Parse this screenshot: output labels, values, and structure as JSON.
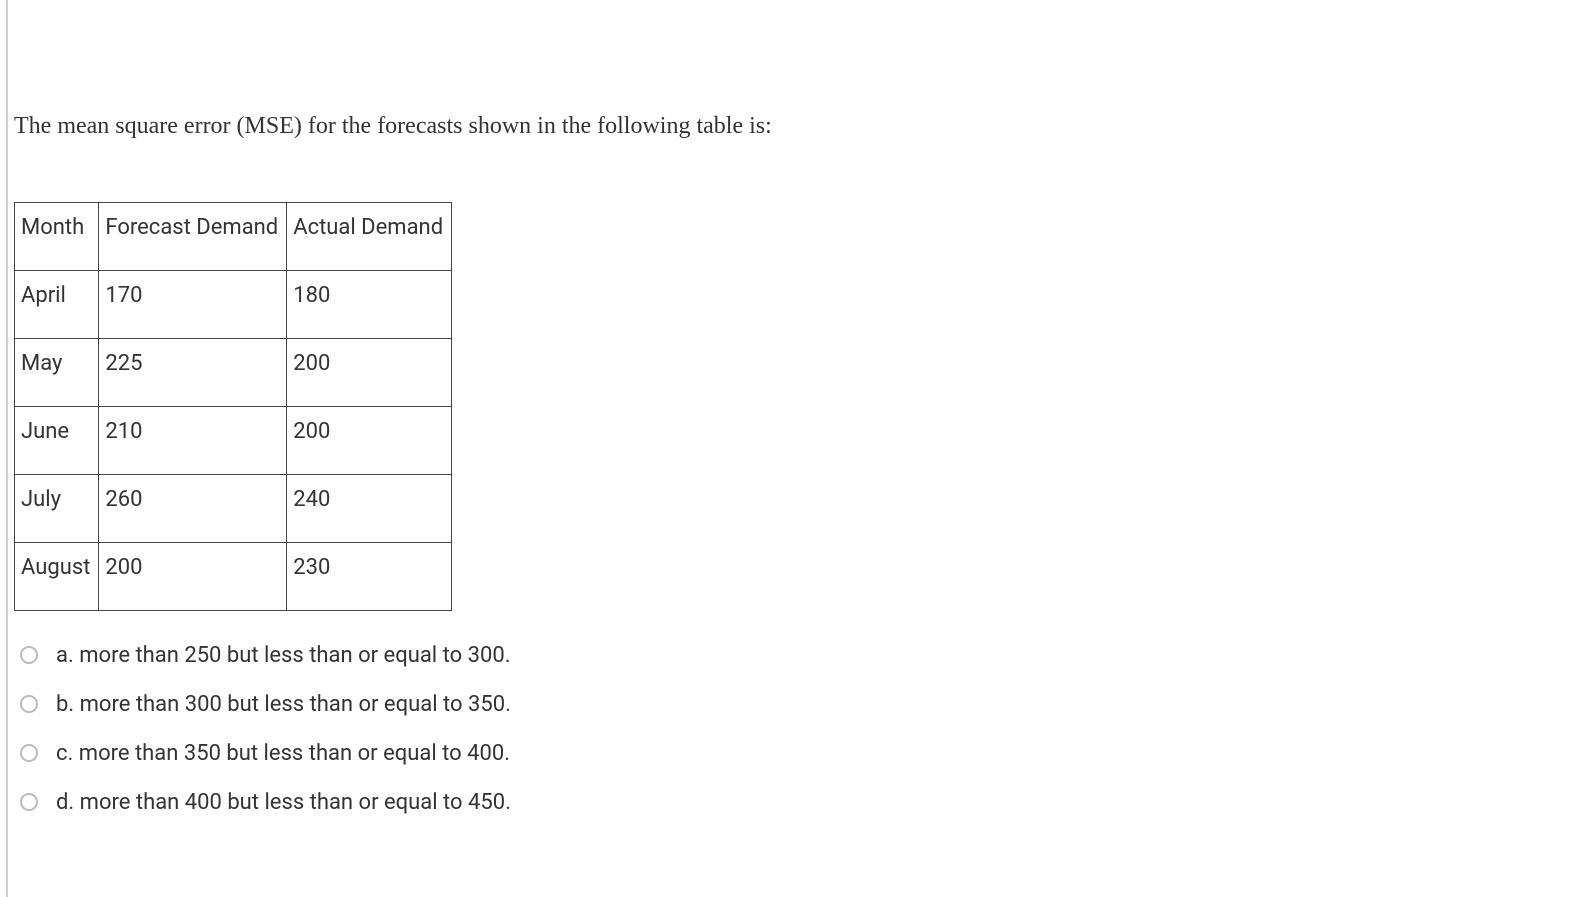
{
  "question": "The mean square error (MSE) for the forecasts shown in the following table is:",
  "table": {
    "headers": [
      "Month",
      "Forecast Demand",
      "Actual Demand"
    ],
    "rows": [
      {
        "month": "April",
        "forecast": "170",
        "actual": "180"
      },
      {
        "month": "May",
        "forecast": "225",
        "actual": "200"
      },
      {
        "month": "June",
        "forecast": "210",
        "actual": "200"
      },
      {
        "month": "July",
        "forecast": "260",
        "actual": "240"
      },
      {
        "month": "August",
        "forecast": "200",
        "actual": "230"
      }
    ]
  },
  "options": [
    {
      "label": "a. more than 250 but less than or equal to 300."
    },
    {
      "label": "b. more than 300 but less than or equal to 350."
    },
    {
      "label": "c. more than 350 but less than or equal to 400."
    },
    {
      "label": "d. more than 400 but less than or equal to 450."
    }
  ]
}
